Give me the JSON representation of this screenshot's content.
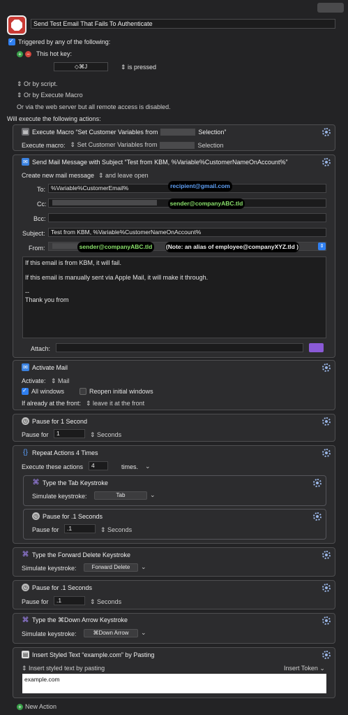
{
  "macro": {
    "title": "Send Test Email That Fails To Authenticate",
    "triggered_label": "Triggered by any of the following:",
    "hotkey_label": "This hot key:",
    "hotkey_value": "◇⌘J",
    "hotkey_state": "is pressed",
    "or_by_script": "Or by script.",
    "or_by_execute_macro": "Or by Execute Macro",
    "web_server_note": "Or via the web server but all remote access is disabled.",
    "will_execute": "Will execute the following actions:"
  },
  "actions": {
    "execute_macro": {
      "title_pre": "Execute Macro “Set Customer Variables from",
      "title_post": "Selection”",
      "field_label": "Execute macro:",
      "popup_pre": "Set Customer Variables from",
      "popup_post": "Selection"
    },
    "send_mail": {
      "title": "Send Mail Message with Subject “Test from KBM, %Variable%CustomerNameOnAccount%”",
      "create_label": "Create new mail message",
      "create_mode": "and leave open",
      "to_label": "To:",
      "to_value": "%Variable%CustomerEmail%",
      "to_annotation": "recipient@gmail.com",
      "cc_label": "Cc:",
      "cc_annotation": "sender@companyABC.tld",
      "bcc_label": "Bcc:",
      "subject_label": "Subject:",
      "subject_value": "Test from KBM, %Variable%CustomerNameOnAccount%",
      "from_label": "From:",
      "from_annotation": "sender@companyABC.tld",
      "from_note": "(Note: an alias of employee@companyXYZ.tld )",
      "body_line1": "If this email is from KBM, it will fail.",
      "body_line2": "If this email is manually sent via Apple Mail, it will make it through.",
      "body_line3": "--",
      "body_line4": "Thank you from",
      "attach_label": "Attach:"
    },
    "activate_mail": {
      "title": "Activate Mail",
      "activate_label": "Activate:",
      "activate_value": "Mail",
      "all_windows": "All windows",
      "reopen_windows": "Reopen initial windows",
      "if_front_label": "If already at the front:",
      "if_front_value": "leave it at the front"
    },
    "pause1": {
      "title": "Pause for 1 Second",
      "label": "Pause for",
      "value": "1",
      "unit": "Seconds"
    },
    "repeat": {
      "title": "Repeat Actions 4 Times",
      "label": "Execute these actions",
      "value": "4",
      "unit": "times.",
      "tab_title": "Type the Tab Keystroke",
      "tab_label": "Simulate keystroke:",
      "tab_value": "Tab",
      "pause_title": "Pause for .1 Seconds",
      "pause_label": "Pause for",
      "pause_value": ".1",
      "pause_unit": "Seconds"
    },
    "forward_delete": {
      "title": "Type the Forward Delete Keystroke",
      "label": "Simulate keystroke:",
      "value": "Forward Delete"
    },
    "pause2": {
      "title": "Pause for .1 Seconds",
      "label": "Pause for",
      "value": ".1",
      "unit": "Seconds"
    },
    "down_arrow": {
      "title": "Type the ⌘Down Arrow Keystroke",
      "label": "Simulate keystroke:",
      "value": "⌘Down Arrow"
    },
    "insert_text": {
      "title": "Insert Styled Text “example.com” by Pasting",
      "mode": "Insert styled text by pasting",
      "insert_token": "Insert Token",
      "text": "example.com"
    }
  },
  "footer": {
    "new_action": "New Action"
  },
  "icons": {
    "macro": "stop-sign-icon",
    "gear": "gear-icon",
    "mail": "mail-icon",
    "command": "command-key-icon",
    "clock": "clock-icon",
    "repeat": "loop-icon"
  },
  "colors": {
    "accent": "#2f7ff0",
    "gear": "#9bb7e8",
    "annotation_blue": "#5e9ff5",
    "annotation_green": "#89e06a"
  }
}
